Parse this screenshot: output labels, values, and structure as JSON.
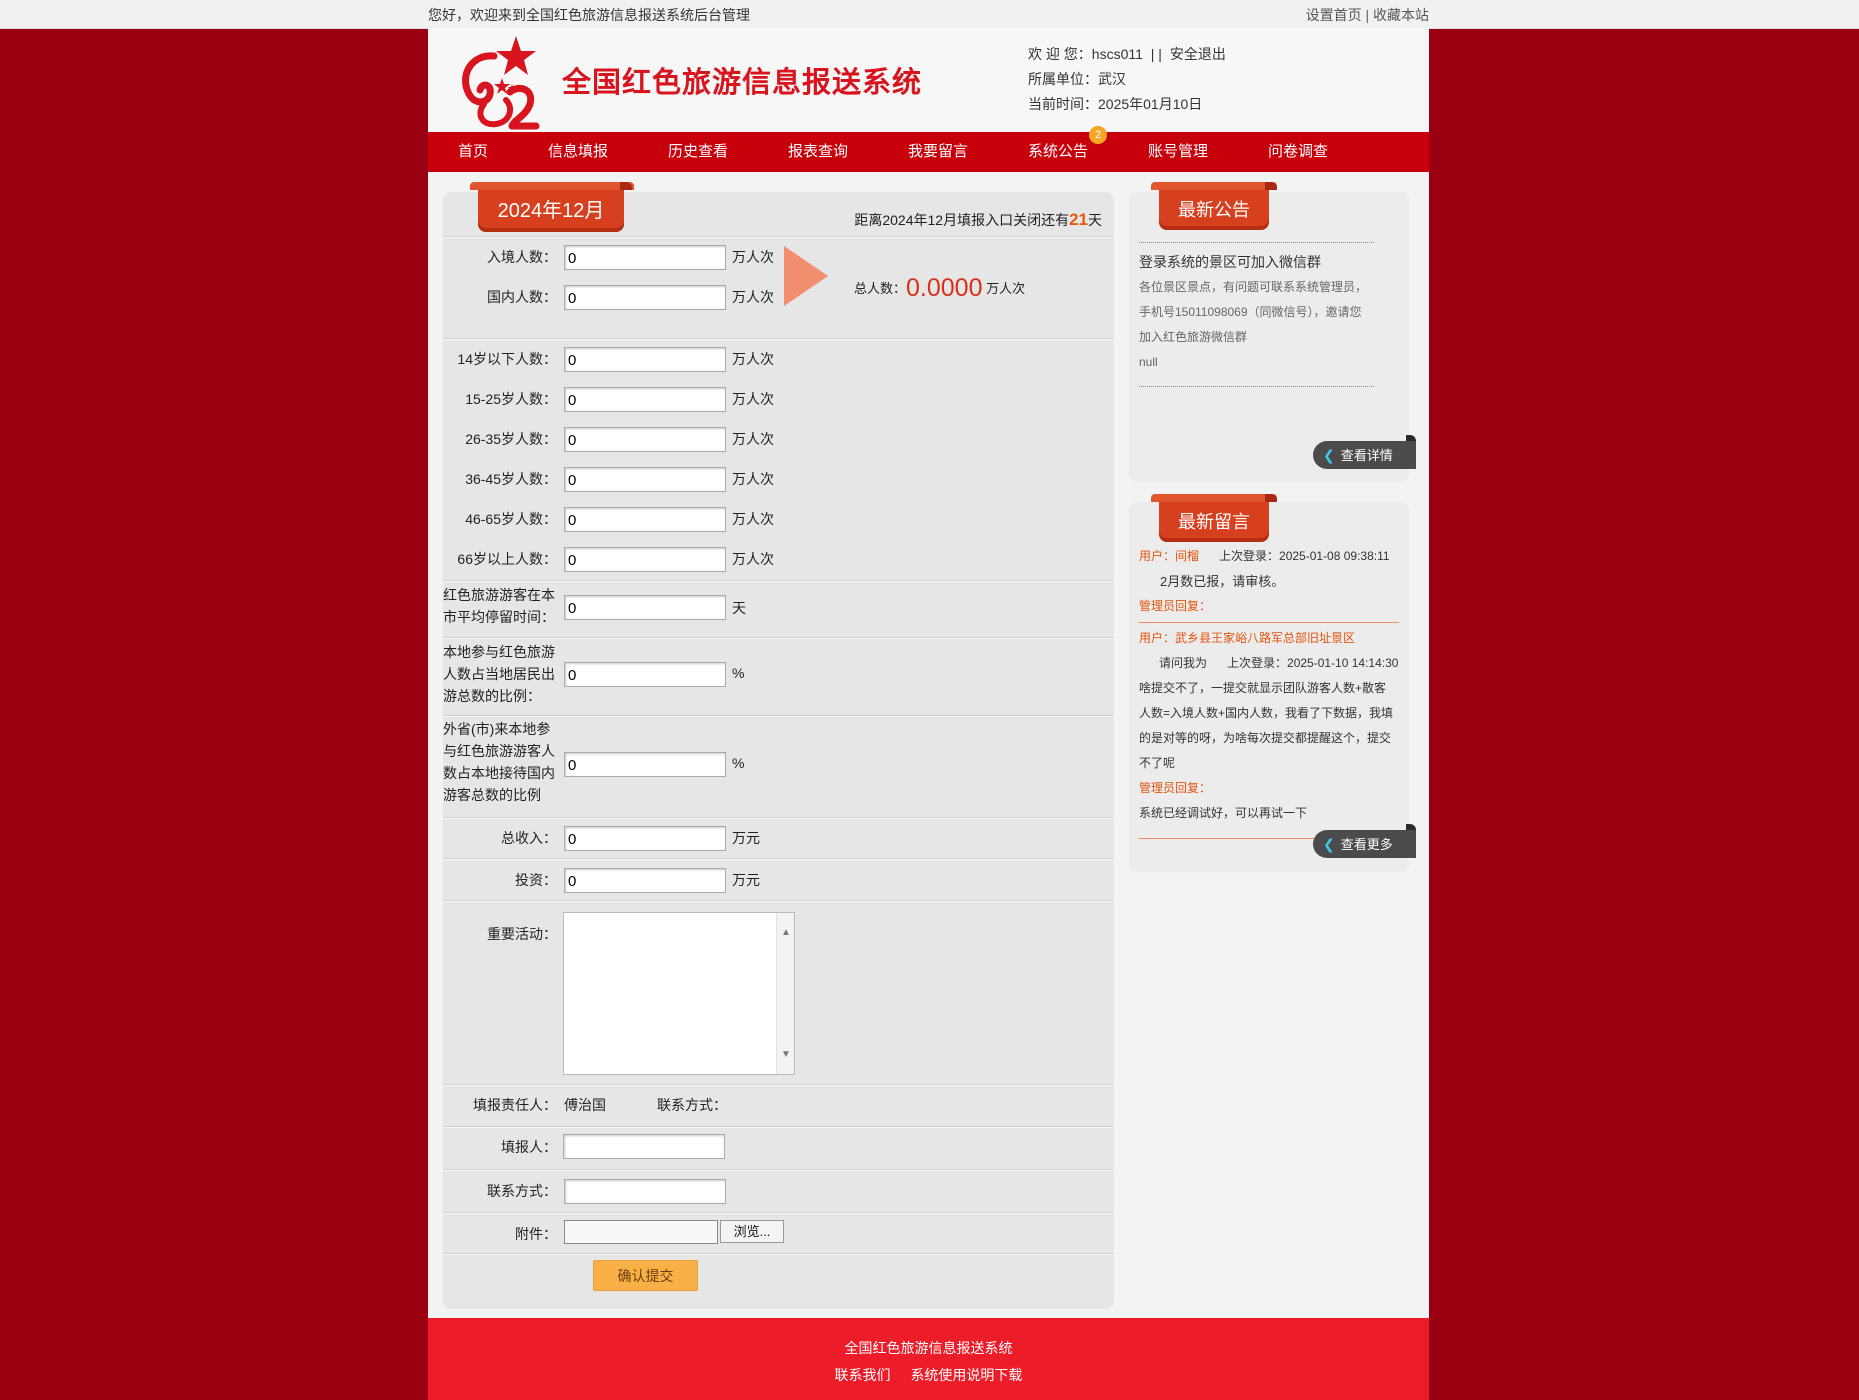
{
  "topbar": {
    "welcome": "您好，欢迎来到全国红色旅游信息报送系统后台管理",
    "set_home": "设置首页",
    "sep": "|",
    "bookmark": "收藏本站"
  },
  "header": {
    "site_title": "全国红色旅游信息报送系统",
    "welcome_label": "欢 迎 您：hscs011",
    "sep": "| |",
    "logout": "安全退出",
    "unit": "所属单位：武汉",
    "time": "当前时间：2025年01月10日"
  },
  "nav": {
    "items": [
      "首页",
      "信息填报",
      "历史查看",
      "报表查询",
      "我要留言",
      "系统公告",
      "账号管理",
      "问卷调查"
    ],
    "badge": "2"
  },
  "form": {
    "month": "2024年12月",
    "countdown_prefix": "距离2024年12月填报入口关闭还有",
    "countdown_days": "21",
    "countdown_suffix": "天",
    "inbound_label": "入境人数：",
    "domestic_label": "国内人数：",
    "unit_person": "万人次",
    "total_label": "总人数：",
    "total_value": "0.0000",
    "total_unit": "万人次",
    "age_labels": [
      "14岁以下人数：",
      "15-25岁人数：",
      "26-35岁人数：",
      "36-45岁人数：",
      "46-65岁人数：",
      "66岁以上人数："
    ],
    "zero": "0",
    "stay_label": "红色旅游游客在本市平均停留时间：",
    "stay_unit": "天",
    "local_ratio_label": "本地参与红色旅游人数占当地居民出游总数的比例：",
    "outside_ratio_label": "外省(市)来本地参与红色旅游游客人数占本地接待国内游客总数的比例",
    "percent": "%",
    "income_label": "总收入：",
    "invest_label": "投资：",
    "money_unit": "万元",
    "activity_label": "重要活动：",
    "responsible_label": "填报责任人：",
    "responsible_name": "傅治国",
    "contact_label": "联系方式：",
    "reporter_label": "填报人：",
    "contact2_label": "联系方式：",
    "attach_label": "附件：",
    "browse": "浏览...",
    "submit": "确认提交"
  },
  "notice": {
    "title": "最新公告",
    "line1": "登录系统的景区可加入微信群",
    "line2": "各位景区景点，有问题可联系系统管理员，",
    "line3": "手机号15011098069（同微信号），邀请您",
    "line4": "加入红色旅游微信群",
    "line5": "null",
    "detail_btn": "查看详情"
  },
  "messages": {
    "title": "最新留言",
    "m1_user": "用户：间榴",
    "m1_login": "上次登录：2025-01-08 09:38:11",
    "m1_content": "2月数已报，请审核。",
    "m1_admin": "管理员回复：",
    "m2_user": "用户：武乡县王家峪八路军总部旧址景区",
    "m2_prefix": "请问我为",
    "m2_login": "上次登录：2025-01-10 14:14:30",
    "m2_content1": "啥提交不了，一提交就显示团队游客人数+散客",
    "m2_content2": "人数=入境人数+国内人数，我看了下数据，我填",
    "m2_content3": "的是对等的呀，为啥每次提交都提醒这个，提交",
    "m2_content4": "不了呢",
    "m2_admin": "管理员回复：",
    "m2_reply": "系统已经调试好，可以再试一下",
    "more_btn": "查看更多"
  },
  "footer": {
    "title": "全国红色旅游信息报送系统",
    "contact": "联系我们",
    "manual": "系统使用说明下载"
  },
  "colors": {
    "brand_red": "#c7000b",
    "background": "#9b0012",
    "ribbon": "#d7401f",
    "accent_orange": "#e85a0c",
    "footer_red": "#ec1c28"
  }
}
